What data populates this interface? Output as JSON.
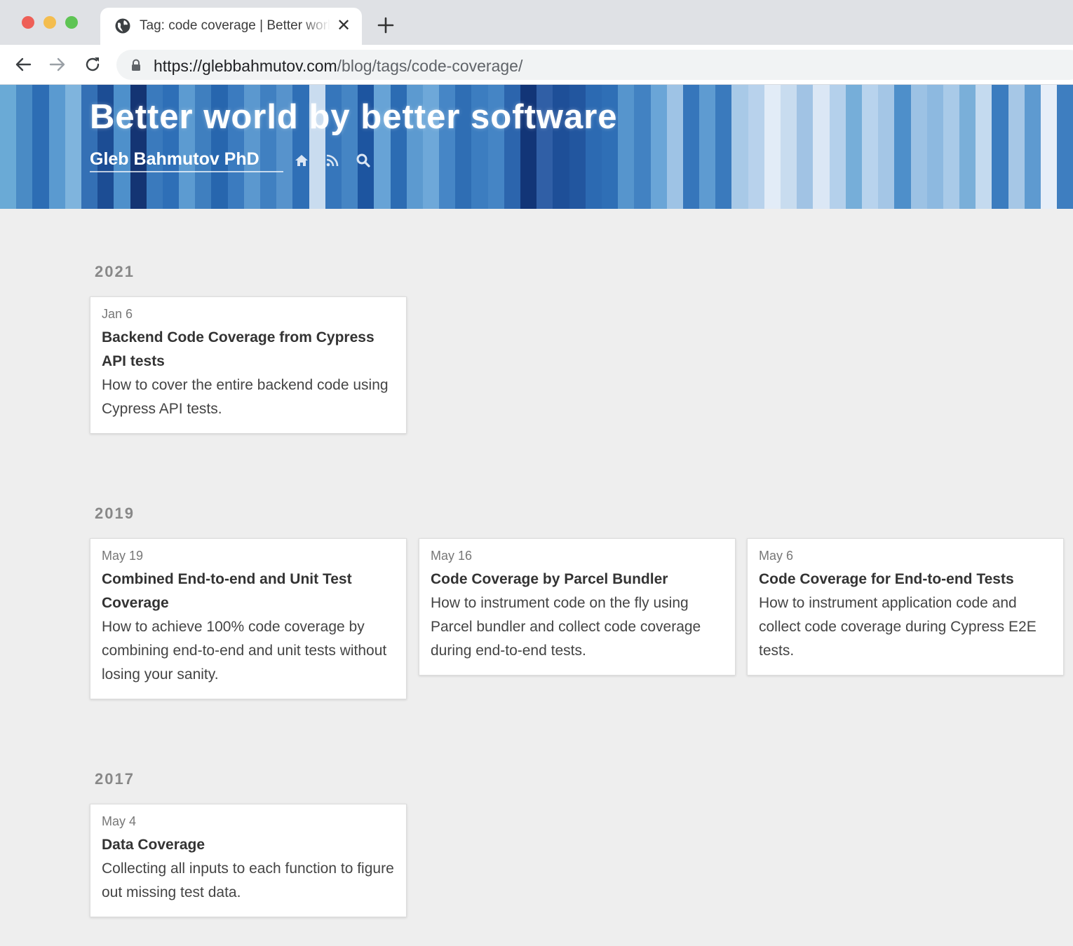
{
  "browser": {
    "tab_title": "Tag: code coverage | Better world by better software",
    "close_glyph": "✕",
    "url_host": "https://glebbahmutov.com",
    "url_path": "/blog/tags/code-coverage/"
  },
  "header": {
    "title": "Better world by better software",
    "author": "Gleb Bahmutov PhD",
    "stripe_colors": [
      "#6aaad6",
      "#4a8bc5",
      "#2d6db4",
      "#5a9ad0",
      "#7fb4dd",
      "#3470b5",
      "#1c4d94",
      "#4e90cb",
      "#143473",
      "#3a7abd",
      "#2e6fb7",
      "#5c9bd1",
      "#3f7fbf",
      "#2766ae",
      "#3b7bbf",
      "#5b98cf",
      "#4080c1",
      "#5793cc",
      "#2f6fb6",
      "#c9dcef",
      "#3676bb",
      "#4585c4",
      "#1d55a0",
      "#67a3d6",
      "#2c6cb3",
      "#5c9ad0",
      "#6ea8d9",
      "#4686c6",
      "#2f6eb4",
      "#3c7dc0",
      "#4585c5",
      "#2c65ad",
      "#123577",
      "#305fa6",
      "#1e4f98",
      "#22569f",
      "#2c6ab2",
      "#2f6fb6",
      "#5695cd",
      "#4282c2",
      "#6aa5d7",
      "#9ec3e5",
      "#3676bb",
      "#5e9bd1",
      "#3a7abd",
      "#a8c9e7",
      "#b8d2ec",
      "#e2ecf7",
      "#c8dcef",
      "#a1c3e4",
      "#dbe7f5",
      "#b4d0eb",
      "#76aed9",
      "#b8d3ed",
      "#a4c6e6",
      "#4e8fca",
      "#9cc2e4",
      "#8db9e0",
      "#a9cae8",
      "#7aafd9",
      "#c4daef",
      "#3b7cbf",
      "#a6c7e6",
      "#5e9ad0",
      "#e6eef8",
      "#3e7ec0"
    ]
  },
  "sections": [
    {
      "year": "2021",
      "posts": [
        {
          "date": "Jan 6",
          "title": "Backend Code Coverage from Cypress API tests",
          "desc": "How to cover the entire backend code using Cypress API tests."
        }
      ]
    },
    {
      "year": "2019",
      "posts": [
        {
          "date": "May 19",
          "title": "Combined End-to-end and Unit Test Coverage",
          "desc": "How to achieve 100% code coverage by combining end-to-end and unit tests without losing your sanity."
        },
        {
          "date": "May 16",
          "title": "Code Coverage by Parcel Bundler",
          "desc": "How to instrument code on the fly using Parcel bundler and collect code coverage during end-to-end tests."
        },
        {
          "date": "May 6",
          "title": "Code Coverage for End-to-end Tests",
          "desc": "How to instrument application code and collect code coverage during Cypress E2E tests."
        }
      ]
    },
    {
      "year": "2017",
      "posts": [
        {
          "date": "May 4",
          "title": "Data Coverage",
          "desc": "Collecting all inputs to each function to figure out missing test data."
        }
      ]
    }
  ]
}
